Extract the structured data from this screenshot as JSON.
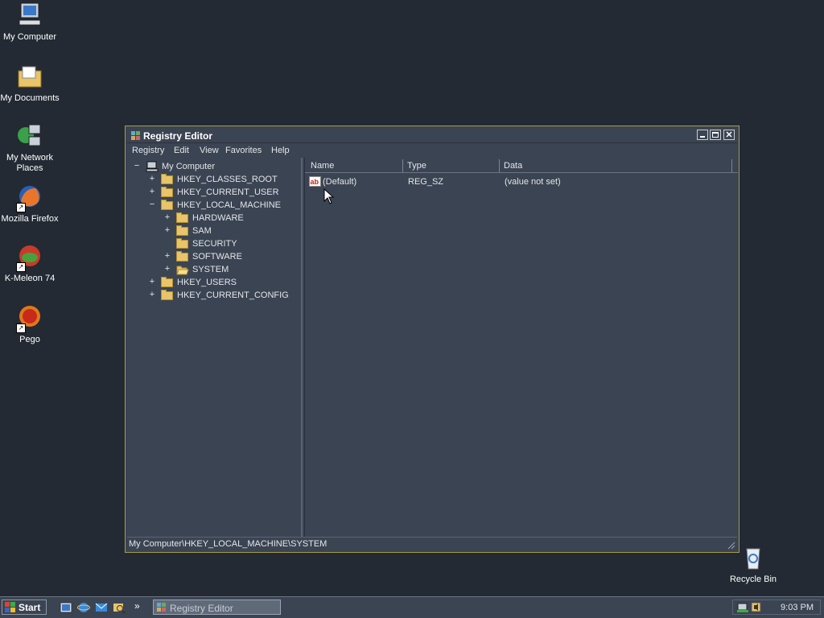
{
  "desktop": {
    "icons": [
      {
        "label": "My Computer"
      },
      {
        "label": "My Documents"
      },
      {
        "label": "My Network Places"
      },
      {
        "label": "Mozilla Firefox"
      },
      {
        "label": "K-Meleon 74"
      },
      {
        "label": "Pego"
      },
      {
        "label": "Recycle Bin"
      }
    ]
  },
  "window": {
    "title": "Registry Editor",
    "menu": [
      "Registry",
      "Edit",
      "View",
      "Favorites",
      "Help"
    ],
    "tree": {
      "root": "My Computer",
      "nodes": [
        {
          "label": "HKEY_CLASSES_ROOT",
          "expander": "+"
        },
        {
          "label": "HKEY_CURRENT_USER",
          "expander": "+"
        },
        {
          "label": "HKEY_LOCAL_MACHINE",
          "expander": "−"
        },
        {
          "label": "HARDWARE",
          "expander": "+"
        },
        {
          "label": "SAM",
          "expander": "+"
        },
        {
          "label": "SECURITY",
          "expander": ""
        },
        {
          "label": "SOFTWARE",
          "expander": "+"
        },
        {
          "label": "SYSTEM",
          "expander": "+"
        },
        {
          "label": "HKEY_USERS",
          "expander": "+"
        },
        {
          "label": "HKEY_CURRENT_CONFIG",
          "expander": "+"
        }
      ]
    },
    "columns": [
      "Name",
      "Type",
      "Data"
    ],
    "values": [
      {
        "name": "(Default)",
        "type": "REG_SZ",
        "data": "(value not set)"
      }
    ],
    "status": "My Computer\\HKEY_LOCAL_MACHINE\\SYSTEM"
  },
  "taskbar": {
    "start_label": "Start",
    "overflow": "»",
    "task_label": "Registry Editor",
    "clock": "9:03 PM"
  },
  "colors": {
    "desktop": "#232a33",
    "window": "#3b4452",
    "window_border": "#a89a4a",
    "folder": "#e8c46a"
  }
}
